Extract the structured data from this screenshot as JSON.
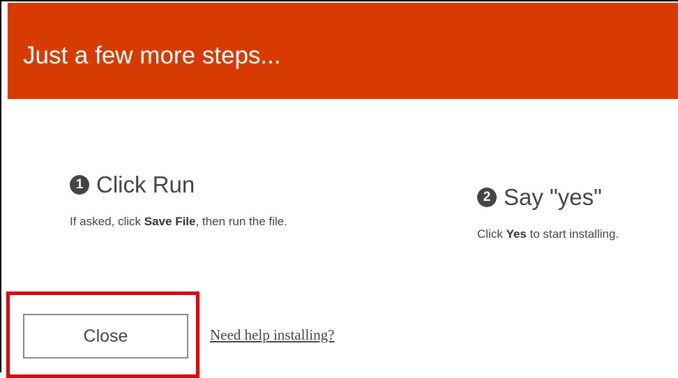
{
  "header": {
    "title": "Just a few more steps..."
  },
  "steps": [
    {
      "number": "1",
      "title": "Click Run",
      "desc_prefix": "If asked, click ",
      "desc_bold": "Save File",
      "desc_suffix": ", then run the file."
    },
    {
      "number": "2",
      "title": "Say \"yes\"",
      "desc_prefix": "Click ",
      "desc_bold": "Yes",
      "desc_suffix": " to start installing."
    }
  ],
  "footer": {
    "close_label": "Close",
    "help_link": "Need help installing?"
  },
  "colors": {
    "header_bg": "#d83b01",
    "highlight": "#e8000b",
    "text": "#444444"
  }
}
